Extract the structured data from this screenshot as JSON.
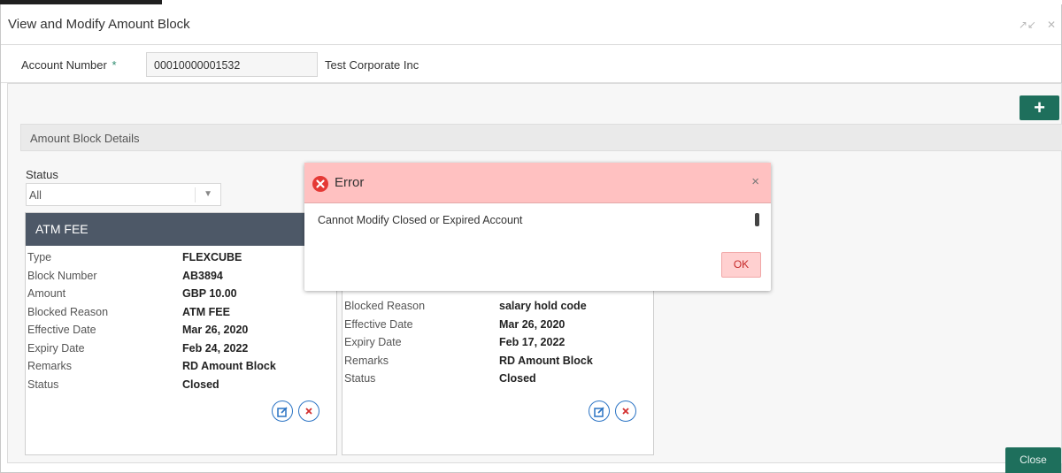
{
  "window": {
    "title": "View and Modify Amount Block",
    "minimize_label": "↗↙",
    "close_label": "✕"
  },
  "account": {
    "label": "Account Number",
    "required_mark": "*",
    "number": "00010000001532",
    "name": "Test Corporate Inc"
  },
  "toolbar": {
    "add_label": "+"
  },
  "section": {
    "title": "Amount Block Details"
  },
  "filter": {
    "label": "Status",
    "value": "All"
  },
  "cards": [
    {
      "header": "ATM FEE",
      "rows": [
        {
          "label": "Type",
          "value": "FLEXCUBE"
        },
        {
          "label": "Block Number",
          "value": "AB3894"
        },
        {
          "label": "Amount",
          "value": "GBP 10.00"
        },
        {
          "label": "Blocked Reason",
          "value": "ATM FEE"
        },
        {
          "label": "Effective Date",
          "value": "Mar 26, 2020"
        },
        {
          "label": "Expiry Date",
          "value": "Feb 24, 2022"
        },
        {
          "label": "Remarks",
          "value": "RD Amount Block"
        },
        {
          "label": "Status",
          "value": "Closed"
        }
      ]
    },
    {
      "header": "",
      "rows": [
        {
          "label": "Blocked Reason",
          "value": "salary hold code"
        },
        {
          "label": "Effective Date",
          "value": "Mar 26, 2020"
        },
        {
          "label": "Expiry Date",
          "value": "Feb 17, 2022"
        },
        {
          "label": "Remarks",
          "value": "RD Amount Block"
        },
        {
          "label": "Status",
          "value": "Closed"
        }
      ]
    }
  ],
  "footer": {
    "close_label": "Close"
  },
  "dialog": {
    "title": "Error",
    "message": "Cannot Modify Closed or Expired Account",
    "ok_label": "OK",
    "close_label": "×"
  },
  "colors": {
    "accent": "#1e6f5c",
    "card_header": "#4d5867",
    "error_header": "#ffc1c1",
    "error_icon": "#e53935",
    "action_icon": "#2a73c4"
  }
}
